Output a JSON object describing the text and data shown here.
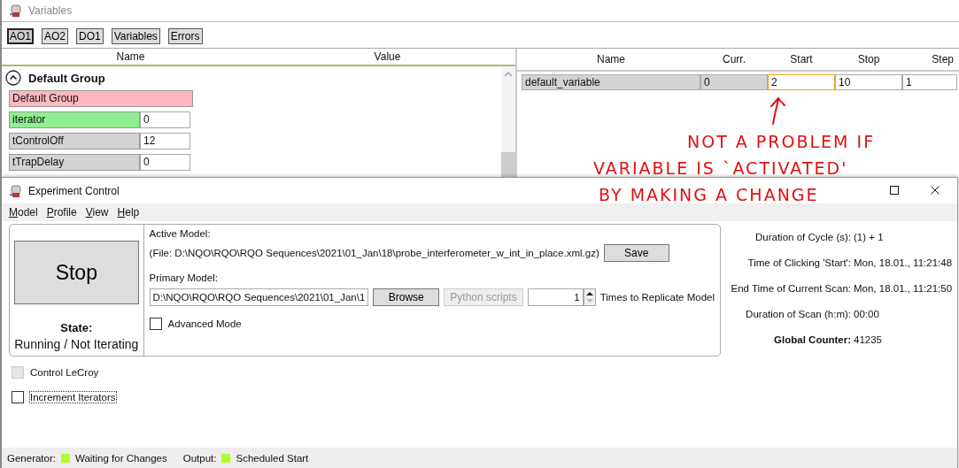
{
  "variables_window": {
    "title": "Variables",
    "tabs": [
      {
        "label": "AO1",
        "selected": true
      },
      {
        "label": "AO2",
        "selected": false
      },
      {
        "label": "DO1",
        "selected": false
      },
      {
        "label": "Variables",
        "selected": false
      },
      {
        "label": "Errors",
        "selected": false
      }
    ],
    "left_columns": [
      "Name",
      "Value"
    ],
    "group": {
      "title": "Default Group",
      "expanded": true,
      "label": "Default Group",
      "rows": [
        {
          "name": "iterator",
          "value": "0",
          "kind": "iterator"
        },
        {
          "name": "tControlOff",
          "value": "12",
          "kind": "plain"
        },
        {
          "name": "tTrapDelay",
          "value": "0",
          "kind": "plain"
        }
      ]
    },
    "right_columns": [
      "Name",
      "Curr.",
      "Start",
      "Stop",
      "Step"
    ],
    "right_rows": [
      {
        "name": "default_variable",
        "curr": "0",
        "start": "2",
        "stop": "10",
        "step": "1",
        "start_focused": true
      }
    ]
  },
  "annotation": {
    "lines": [
      "NOT A PROBLEM IF",
      "VARIABLE IS `ACTIVATED'",
      "BY MAKING A CHANGE"
    ]
  },
  "experiment_window": {
    "title": "Experiment Control",
    "menu": [
      "Model",
      "Profile",
      "View",
      "Help"
    ],
    "stop_button": "Stop",
    "state_label": "State:",
    "state_value": "Running / Not Iterating",
    "active_model_label": "Active Model:",
    "active_file": "(File: D:\\NQO\\RQO\\RQO Sequences\\2021\\01_Jan\\18\\probe_interferometer_w_int_in_place.xml.gz)",
    "save_button": "Save",
    "primary_model_label": "Primary Model:",
    "primary_model_path": "D:\\NQO\\RQO\\RQO Sequences\\2021\\01_Jan\\1",
    "browse_button": "Browse",
    "python_button": {
      "label": "Python scripts",
      "disabled": true
    },
    "replicate": {
      "value": "1",
      "label": "Times to Replicate Model"
    },
    "advanced_mode": {
      "label": "Advanced Mode",
      "checked": false
    },
    "options": [
      {
        "label": "Control LeCroy",
        "checked": false,
        "disabled": true
      },
      {
        "label": "Increment Iterators",
        "checked": false,
        "disabled": false
      }
    ],
    "info": [
      {
        "label": "Duration of Cycle (s):",
        "value": "(1) + 1",
        "kind": "plain"
      },
      {
        "label": "Time of Clicking 'Start':",
        "value": "Mon, 18.01., 11:21:48",
        "kind": "plain"
      },
      {
        "label": "End Time of Current Scan:",
        "value": "Mon, 18.01., 11:21:50",
        "kind": "plain"
      },
      {
        "label": "Duration of Scan (h:m):",
        "value": "00:00",
        "kind": "plain"
      },
      {
        "label": "Global Counter:",
        "value": "41235",
        "kind": "counter"
      }
    ],
    "status_bar": [
      {
        "label": "Generator:",
        "status": "Waiting for Changes",
        "color": "#adff2f"
      },
      {
        "label": "Output:",
        "status": "Scheduled Start",
        "color": "#adff2f"
      }
    ]
  }
}
